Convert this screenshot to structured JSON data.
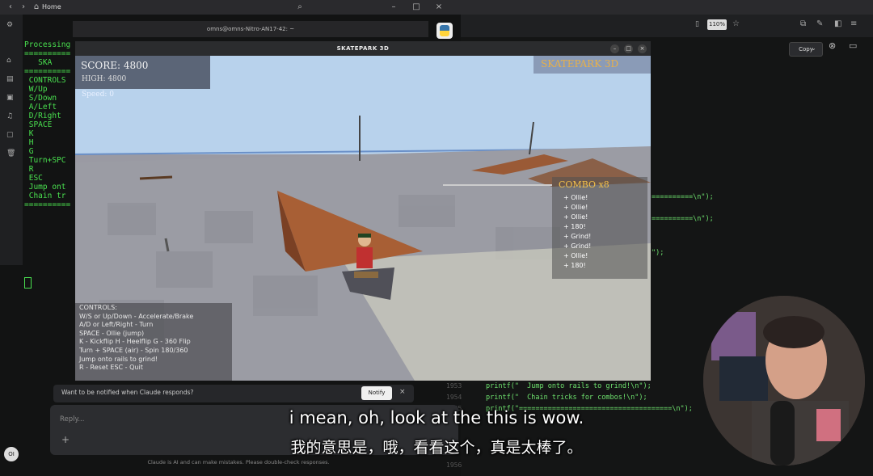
{
  "browser": {
    "tab_title": "Home",
    "zoom": "110%",
    "copy_label": "Copy"
  },
  "terminal": {
    "title": "omns@omns-Nitro-AN17-42: ~",
    "lines": [
      "Processing",
      "",
      "==========",
      "   SKA",
      "==========",
      "",
      " CONTROLS",
      " W/Up",
      " S/Down",
      " A/Left",
      " D/Right",
      " SPACE",
      " K",
      " H",
      " G",
      " Turn+SPC",
      " R",
      " ESC",
      "",
      " Jump ont",
      " Chain tr",
      "=========="
    ]
  },
  "editor": {
    "line1": "==========\\n\");",
    "line2": "==========\\n\");",
    "line3": "\");",
    "line4": "printf(\"  Jump onto rails to grind!\\n\");",
    "line5": "printf(\"  Chain tricks for combos!\\n\");",
    "line6": "printf(\"=====================================\\n\");",
    "num4": "1953",
    "num5": "1954",
    "num6": "1955",
    "num7": "1956"
  },
  "game": {
    "window_title": "SKATEPARK 3D",
    "score": "SCORE: 4800",
    "high": "HIGH: 4800",
    "speed": "Speed: 0",
    "brand": "SKATEPARK 3D",
    "combo_title": "COMBO x8",
    "combo_items": [
      "+ Ollie!",
      "+ Ollie!",
      "+ Ollie!",
      "+ 180!",
      "+ Grind!",
      "+ Grind!",
      "+ Ollie!",
      "+ 180!"
    ],
    "controls": [
      "CONTROLS:",
      "W/S or Up/Down - Accelerate/Brake",
      "A/D or Left/Right - Turn",
      "SPACE - Ollie (jump)",
      "K - Kickflip  H - Heelflip  G - 360 Flip",
      "Turn + SPACE (air) - Spin 180/360",
      "Jump onto rails to grind!",
      "R - Reset  ESC - Quit"
    ]
  },
  "chat": {
    "notify_prompt": "Want to be notified when Claude responds?",
    "notify_button": "Notify",
    "reply_placeholder": "Reply...",
    "disclaimer": "Claude is AI and can make mistakes. Please double-check responses.",
    "avatar": "OI"
  },
  "subtitles": {
    "english": "i mean, oh, look at the this is wow.",
    "chinese": "我的意思是，哦，看看这个，真是太棒了。"
  }
}
